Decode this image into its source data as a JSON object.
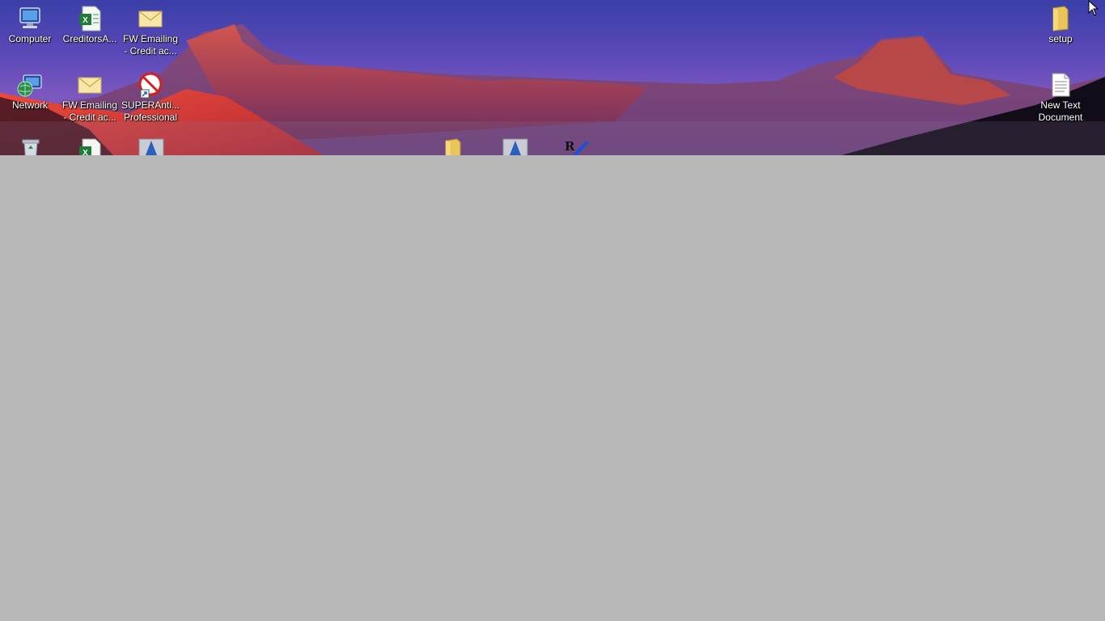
{
  "desktop": {
    "icons": [
      {
        "name": "computer-icon",
        "label": "Computer"
      },
      {
        "name": "excel-file-icon",
        "label": "CreditorsA..."
      },
      {
        "name": "email-message-icon",
        "label": "FW  Emailing - Credit ac..."
      },
      {
        "name": "network-icon",
        "label": "Network"
      },
      {
        "name": "email-message-icon",
        "label": "FW  Emailing - Credit ac..."
      },
      {
        "name": "superantispyware-icon",
        "label": "SUPERAnti... Professional"
      },
      {
        "name": "folder-icon",
        "label": "setup"
      },
      {
        "name": "text-document-icon",
        "label": "New Text Document"
      }
    ],
    "partial_icons": [
      "recycle-bin-icon",
      "excel-file-icon",
      "installer-icon",
      "folder-icon",
      "installer-icon",
      "rx-application-icon"
    ]
  },
  "colors": {
    "desktop_blank": "#b8b8b8",
    "sky_top": "#3b3fa8",
    "sky_bottom": "#8a5fb6",
    "cliff_red": "#c9453f",
    "label_text": "#ffffff"
  }
}
